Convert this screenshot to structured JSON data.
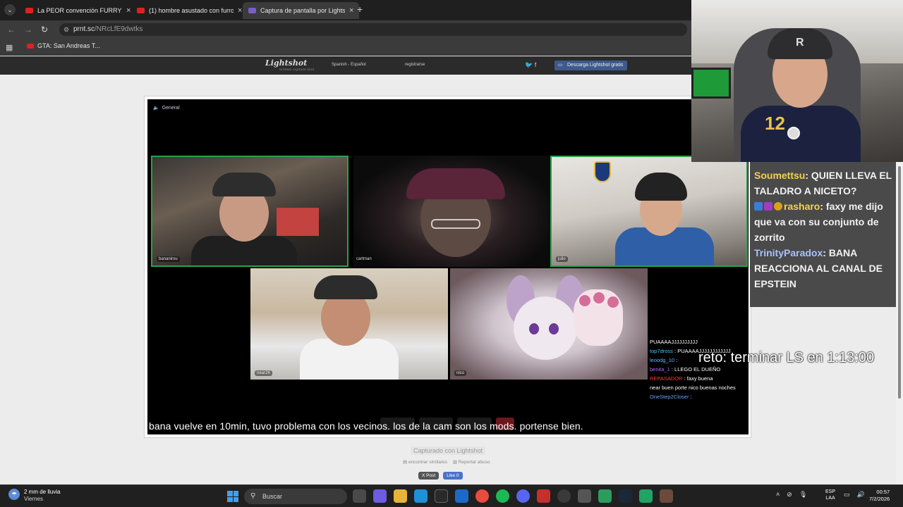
{
  "browser": {
    "tabs": [
      {
        "label": "La PEOR convención FURRY - Y"
      },
      {
        "label": "(1) hombre asustado con furro"
      },
      {
        "label": "Captura de pantalla por Lightsh"
      }
    ],
    "url_domain": "prnt.sc",
    "url_path": "/NRcLfE9dwtks",
    "bookmark": "GTA: San Andreas T..."
  },
  "lightshot": {
    "logo": "Lightshot",
    "logo_sub": "screen capture tool",
    "language": "Spanish - Español",
    "register": "registrarse",
    "download": "Descarga Lightshot gratis",
    "caption": "Capturado con Lightshot",
    "find_similar": "encontrar similares",
    "report": "Reportar abuso",
    "post": "X Post",
    "like": "Like 0"
  },
  "screenshot": {
    "channel": "General",
    "participants": [
      "bananirou",
      "cartman",
      "julio",
      "near2K",
      "nico"
    ],
    "chat": [
      {
        "user": "",
        "text": "PUAAAAJJJJJJJJJJ"
      },
      {
        "user": "top7dross",
        "text": ": PUAAAAJJJJJJJJJJJJ"
      },
      {
        "user": "leoodg_10",
        "text": ":"
      },
      {
        "user": "benita_1",
        "text": ": LLEGO EL DUEÑO"
      },
      {
        "user": "REPASADOR",
        "text": ": faxy buena"
      },
      {
        "user": "",
        "text": "near buen porte nico buenas noches"
      },
      {
        "user": "OneStep2Closer",
        "text": ":"
      }
    ],
    "subtitle": "bana vuelve en 10min, tuvo problema con los vecinos. los de la cam son los mods. portense bien."
  },
  "stream": {
    "reto": "reto: terminar LS en 1:13:00",
    "chat": [
      {
        "user": "Soumettsu",
        "text": ": QUIEN LLEVA EL TALADRO A NICETO?"
      },
      {
        "user": "rasharo",
        "text": ": faxy me dijo que va con su conjunto de zorrito"
      },
      {
        "user": "TrinityParadox",
        "text": ": BANA REACCIONA AL CANAL DE EPSTEIN"
      }
    ],
    "jersey_number": "12"
  },
  "taskbar": {
    "weather_temp": "2 mm de lluvia",
    "weather_day": "Viernes",
    "search_placeholder": "Buscar",
    "lang_top": "ESP",
    "lang_bottom": "LAA",
    "time": "00:57",
    "date": "7/2/2026"
  }
}
